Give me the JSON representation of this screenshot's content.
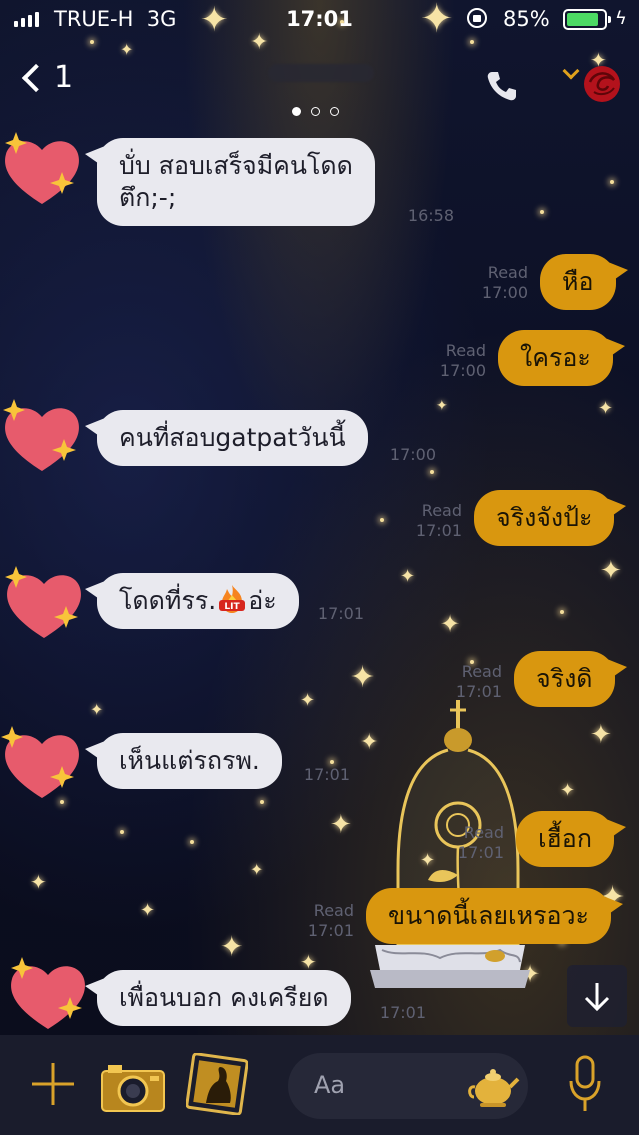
{
  "status_bar": {
    "carrier": "TRUE-H",
    "network": "3G",
    "time": "17:01",
    "battery": "85%",
    "battery_level": 0.85
  },
  "nav": {
    "back_count": "1",
    "page_indicator": {
      "total": 3,
      "active": 1
    }
  },
  "messages": [
    {
      "side": "in",
      "lines": [
        "บั่บ สอบเสร็จมีคนโดด",
        "ตึก;-;"
      ],
      "time": "16:58"
    },
    {
      "side": "out",
      "text": "หือ",
      "read": "Read",
      "time": "17:00"
    },
    {
      "side": "out",
      "text": "ใครอะ",
      "read": "Read",
      "time": "17:00"
    },
    {
      "side": "in",
      "text": "คนที่สอบgatpatวันนี้",
      "time": "17:00"
    },
    {
      "side": "out",
      "text": "จริงจังป้ะ",
      "read": "Read",
      "time": "17:01"
    },
    {
      "side": "in",
      "text_before": "โดดที่รร.",
      "text_after": "อ่ะ",
      "emoji": "LIT",
      "time": "17:01"
    },
    {
      "side": "out",
      "text": "จริงดิ",
      "read": "Read",
      "time": "17:01"
    },
    {
      "side": "in",
      "text": "เห็นแต่รถรพ.",
      "time": "17:01"
    },
    {
      "side": "out",
      "text": "เฮื้อก",
      "read": "Read",
      "time": "17:01"
    },
    {
      "side": "out",
      "text": "ขนาดนี้เลยเหรอวะ",
      "read": "Read",
      "time": "17:01"
    },
    {
      "side": "in",
      "text": "เพื่อนบอก คงเครียด",
      "time": "17:01"
    }
  ],
  "input": {
    "placeholder": "Aa"
  },
  "colors": {
    "outgoing_bubble": "#d9970f",
    "incoming_bubble": "#e9e9ef",
    "accent_gold": "#e0a21c",
    "background": "#0b0f24"
  },
  "icons": [
    "signal-icon",
    "lock-rotation-icon",
    "battery-icon",
    "charging-icon",
    "back-icon",
    "phone-icon",
    "rose-icon",
    "heart-avatar-icon",
    "scroll-down-icon",
    "plus-icon",
    "camera-icon",
    "gallery-icon",
    "sticker-teapot-icon",
    "microphone-icon"
  ]
}
